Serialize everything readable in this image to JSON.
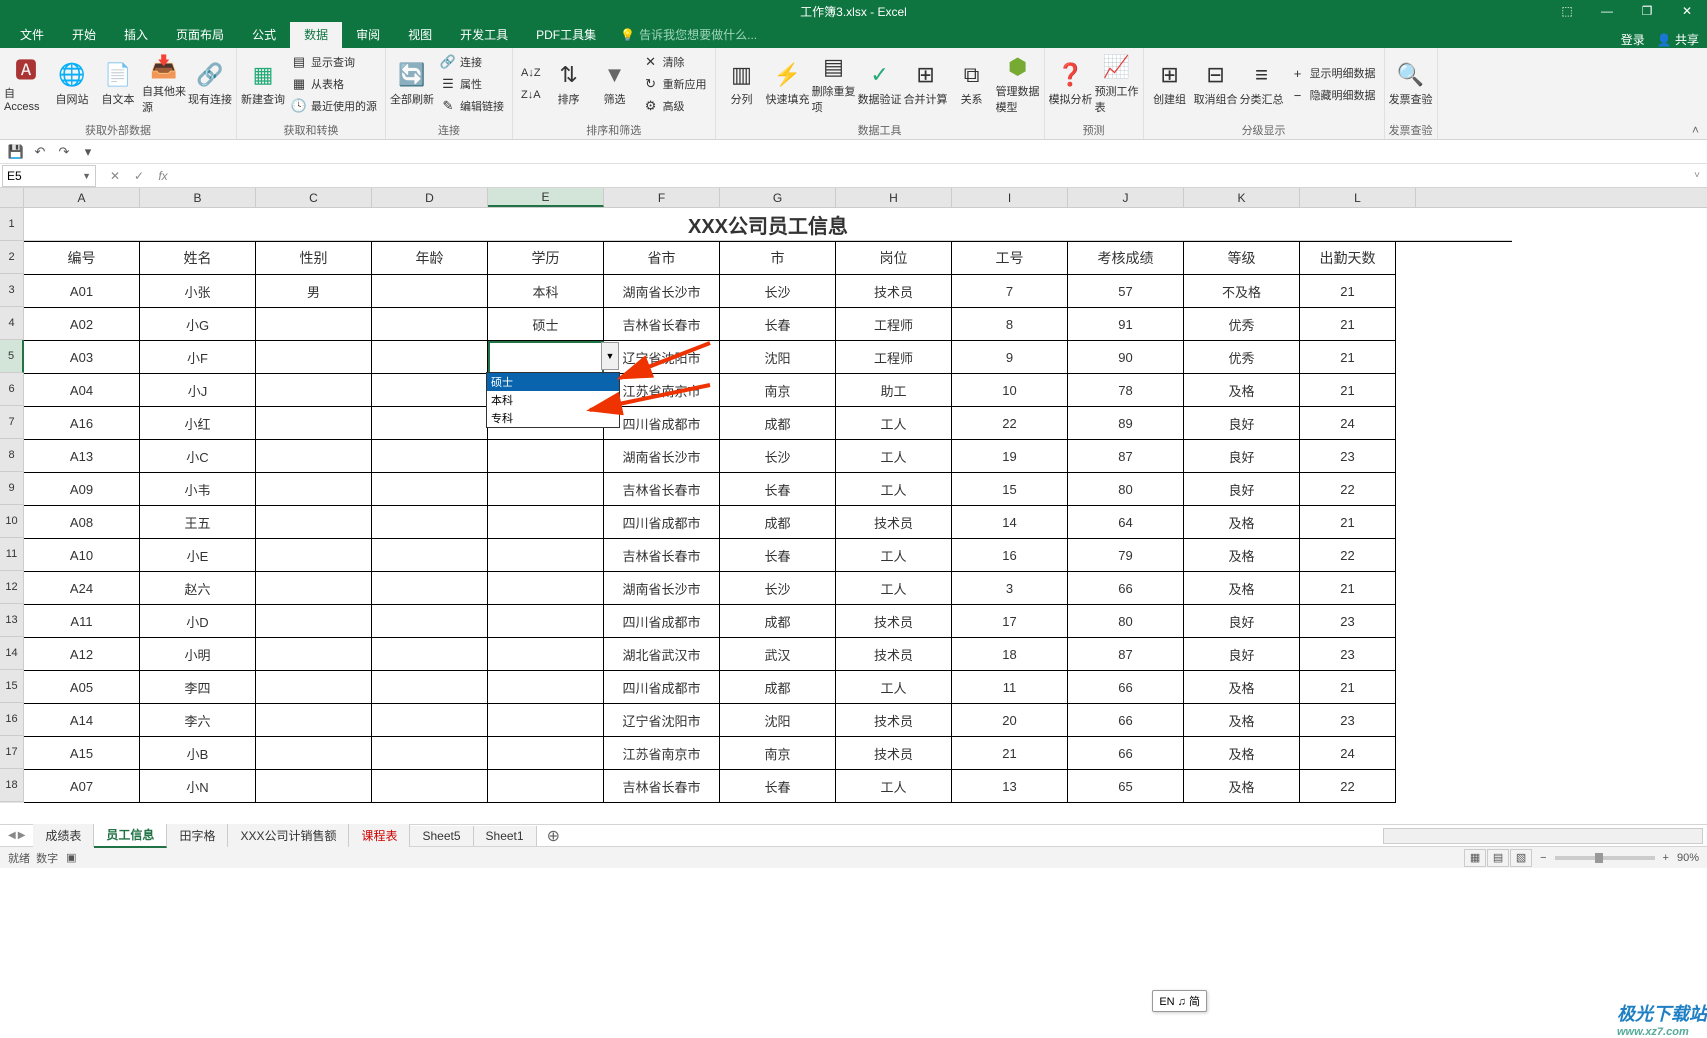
{
  "app": {
    "title": "工作簿3.xlsx - Excel"
  },
  "window_buttons": {
    "options": "⬚",
    "min": "—",
    "restore": "❐",
    "close": "✕"
  },
  "tabs": {
    "file": "文件",
    "home": "开始",
    "insert": "插入",
    "layout": "页面布局",
    "formula": "公式",
    "data": "数据",
    "review": "审阅",
    "view": "视图",
    "dev": "开发工具",
    "pdf": "PDF工具集",
    "tellme": "告诉我您想要做什么...",
    "login": "登录",
    "share": "共享"
  },
  "ribbon": {
    "g1": {
      "access": "自 Access",
      "web": "自网站",
      "text": "自文本",
      "other": "自其他来源",
      "existing": "现有连接",
      "label": "获取外部数据"
    },
    "g2": {
      "newquery": "新建查询",
      "showq": "显示查询",
      "fromtable": "从表格",
      "recent": "最近使用的源",
      "label": "获取和转换"
    },
    "g3": {
      "refresh": "全部刷新",
      "conn": "连接",
      "prop": "属性",
      "editlink": "编辑链接",
      "label": "连接"
    },
    "g4": {
      "az": "A↓Z",
      "za": "Z↓A",
      "sort": "排序",
      "filter": "筛选",
      "clear": "清除",
      "reapply": "重新应用",
      "adv": "高级",
      "label": "排序和筛选"
    },
    "g5": {
      "split": "分列",
      "flash": "快速填充",
      "dup": "删除重复项",
      "valid": "数据验证",
      "consol": "合并计算",
      "rel": "关系",
      "model": "管理数据模型",
      "label": "数据工具"
    },
    "g6": {
      "whatif": "模拟分析",
      "forecast": "预测工作表",
      "label": "预测"
    },
    "g7": {
      "group": "创建组",
      "ungroup": "取消组合",
      "subtotal": "分类汇总",
      "showdetail": "显示明细数据",
      "hidedetail": "隐藏明细数据",
      "label": "分级显示"
    },
    "g8": {
      "invoice": "发票查验",
      "label": "发票查验"
    }
  },
  "namebox": "E5",
  "fbar_buttons": {
    "cancel": "✕",
    "ok": "✓",
    "fx": "fx"
  },
  "sheet": {
    "title": "XXX公司员工信息",
    "columns": [
      "A",
      "B",
      "C",
      "D",
      "E",
      "F",
      "G",
      "H",
      "I",
      "J",
      "K",
      "L"
    ],
    "headers": [
      "编号",
      "姓名",
      "性别",
      "年龄",
      "学历",
      "省市",
      "市",
      "岗位",
      "工号",
      "考核成绩",
      "等级",
      "出勤天数"
    ],
    "rows": [
      {
        "id": "A01",
        "name": "小张",
        "sex": "男",
        "age": "",
        "edu": "本科",
        "prov": "湖南省长沙市",
        "city": "长沙",
        "post": "技术员",
        "no": "7",
        "score": "57",
        "grade": "不及格",
        "days": "21"
      },
      {
        "id": "A02",
        "name": "小G",
        "sex": "",
        "age": "",
        "edu": "硕士",
        "prov": "吉林省长春市",
        "city": "长春",
        "post": "工程师",
        "no": "8",
        "score": "91",
        "grade": "优秀",
        "days": "21"
      },
      {
        "id": "A03",
        "name": "小F",
        "sex": "",
        "age": "",
        "edu": "",
        "prov": "辽宁省沈阳市",
        "city": "沈阳",
        "post": "工程师",
        "no": "9",
        "score": "90",
        "grade": "优秀",
        "days": "21"
      },
      {
        "id": "A04",
        "name": "小J",
        "sex": "",
        "age": "",
        "edu": "",
        "prov": "江苏省南京市",
        "city": "南京",
        "post": "助工",
        "no": "10",
        "score": "78",
        "grade": "及格",
        "days": "21"
      },
      {
        "id": "A16",
        "name": "小红",
        "sex": "",
        "age": "",
        "edu": "",
        "prov": "四川省成都市",
        "city": "成都",
        "post": "工人",
        "no": "22",
        "score": "89",
        "grade": "良好",
        "days": "24"
      },
      {
        "id": "A13",
        "name": "小C",
        "sex": "",
        "age": "",
        "edu": "",
        "prov": "湖南省长沙市",
        "city": "长沙",
        "post": "工人",
        "no": "19",
        "score": "87",
        "grade": "良好",
        "days": "23"
      },
      {
        "id": "A09",
        "name": "小韦",
        "sex": "",
        "age": "",
        "edu": "",
        "prov": "吉林省长春市",
        "city": "长春",
        "post": "工人",
        "no": "15",
        "score": "80",
        "grade": "良好",
        "days": "22"
      },
      {
        "id": "A08",
        "name": "王五",
        "sex": "",
        "age": "",
        "edu": "",
        "prov": "四川省成都市",
        "city": "成都",
        "post": "技术员",
        "no": "14",
        "score": "64",
        "grade": "及格",
        "days": "21"
      },
      {
        "id": "A10",
        "name": "小E",
        "sex": "",
        "age": "",
        "edu": "",
        "prov": "吉林省长春市",
        "city": "长春",
        "post": "工人",
        "no": "16",
        "score": "79",
        "grade": "及格",
        "days": "22"
      },
      {
        "id": "A24",
        "name": "赵六",
        "sex": "",
        "age": "",
        "edu": "",
        "prov": "湖南省长沙市",
        "city": "长沙",
        "post": "工人",
        "no": "3",
        "score": "66",
        "grade": "及格",
        "days": "21"
      },
      {
        "id": "A11",
        "name": "小D",
        "sex": "",
        "age": "",
        "edu": "",
        "prov": "四川省成都市",
        "city": "成都",
        "post": "技术员",
        "no": "17",
        "score": "80",
        "grade": "良好",
        "days": "23"
      },
      {
        "id": "A12",
        "name": "小明",
        "sex": "",
        "age": "",
        "edu": "",
        "prov": "湖北省武汉市",
        "city": "武汉",
        "post": "技术员",
        "no": "18",
        "score": "87",
        "grade": "良好",
        "days": "23"
      },
      {
        "id": "A05",
        "name": "李四",
        "sex": "",
        "age": "",
        "edu": "",
        "prov": "四川省成都市",
        "city": "成都",
        "post": "工人",
        "no": "11",
        "score": "66",
        "grade": "及格",
        "days": "21"
      },
      {
        "id": "A14",
        "name": "李六",
        "sex": "",
        "age": "",
        "edu": "",
        "prov": "辽宁省沈阳市",
        "city": "沈阳",
        "post": "技术员",
        "no": "20",
        "score": "66",
        "grade": "及格",
        "days": "23"
      },
      {
        "id": "A15",
        "name": "小B",
        "sex": "",
        "age": "",
        "edu": "",
        "prov": "江苏省南京市",
        "city": "南京",
        "post": "技术员",
        "no": "21",
        "score": "66",
        "grade": "及格",
        "days": "24"
      },
      {
        "id": "A07",
        "name": "小N",
        "sex": "",
        "age": "",
        "edu": "",
        "prov": "吉林省长春市",
        "city": "长春",
        "post": "工人",
        "no": "13",
        "score": "65",
        "grade": "及格",
        "days": "22"
      }
    ],
    "rownums": [
      "1",
      "2",
      "3",
      "4",
      "5",
      "6",
      "7",
      "8",
      "9",
      "10",
      "11",
      "12",
      "13",
      "14",
      "15",
      "16",
      "17",
      "18"
    ]
  },
  "dropdown": {
    "items": [
      "硕士",
      "本科",
      "专科"
    ],
    "highlighted": 0
  },
  "sheets": {
    "s1": "成绩表",
    "s2": "员工信息",
    "s3": "田字格",
    "s4": "XXX公司计销售额",
    "s5": "课程表",
    "s6": "Sheet5",
    "s7": "Sheet1"
  },
  "ime": "EN ♫ 简",
  "status": {
    "ready": "就绪",
    "num": "数字",
    "zoom": "90%",
    "plus": "+",
    "minus": "−"
  },
  "watermark": {
    "main": "极光下载站",
    "sub": "www.xz7.com"
  }
}
